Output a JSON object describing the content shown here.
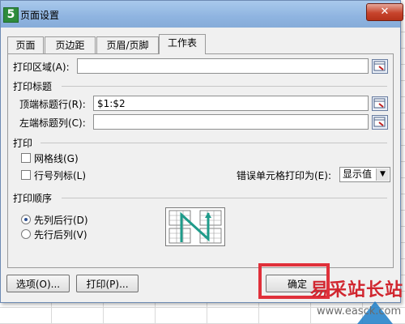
{
  "window": {
    "title": "页面设置",
    "app_icon_letter": "5",
    "close_symbol": "✕"
  },
  "tabs": [
    {
      "label": "页面"
    },
    {
      "label": "页边距"
    },
    {
      "label": "页眉/页脚"
    },
    {
      "label": "工作表",
      "active": true
    }
  ],
  "print_area": {
    "label": "打印区域(A):",
    "value": ""
  },
  "print_titles": {
    "section": "打印标题",
    "rows_label": "顶端标题行(R):",
    "rows_value": "$1:$2",
    "cols_label": "左端标题列(C):",
    "cols_value": ""
  },
  "print": {
    "section": "打印",
    "gridlines_label": "网格线(G)",
    "gridlines_checked": false,
    "headings_label": "行号列标(L)",
    "headings_checked": false,
    "errors_label": "错误单元格打印为(E):",
    "errors_value": "显示值"
  },
  "page_order": {
    "section": "打印顺序",
    "option1": "先列后行(D)",
    "option2": "先行后列(V)",
    "selected": "option1"
  },
  "buttons": {
    "options": "选项(O)...",
    "print": "打印(P)...",
    "ok": "确定"
  },
  "watermark": {
    "text": "易采站长站",
    "url": "www.easck.com"
  },
  "colors": {
    "highlight": "#e0303a",
    "titlebar": "#8fb4e0",
    "dialog_bg": "#f0f0f0"
  }
}
